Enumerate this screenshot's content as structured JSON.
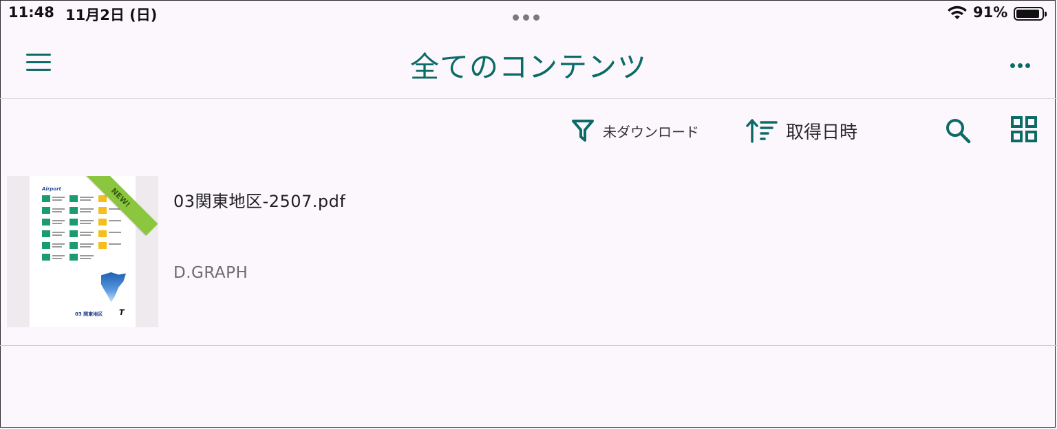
{
  "status_bar": {
    "time": "11:48",
    "date": "11月2日 (日)",
    "battery_percent": "91%",
    "battery_level": 0.91
  },
  "header": {
    "title": "全てのコンテンツ",
    "menu_icon": "hamburger-menu-icon",
    "more_icon": "more-horizontal-icon"
  },
  "toolbar": {
    "filter_label": "未ダウンロード",
    "sort_label": "取得日時",
    "filter_icon": "filter-icon",
    "sort_icon": "sort-ascending-icon",
    "search_icon": "search-icon",
    "grid_icon": "grid-view-icon"
  },
  "items": [
    {
      "filename": "03関東地区-2507.pdf",
      "publisher": "D.GRAPH",
      "thumbnail": {
        "brand_left": "Airport",
        "ribbon": "NEW!",
        "footer": "03 関東地区",
        "logo": "T"
      }
    }
  ],
  "colors": {
    "accent": "#0b6b66",
    "background": "#fcf6fd",
    "ribbon": "#8cc63f"
  }
}
